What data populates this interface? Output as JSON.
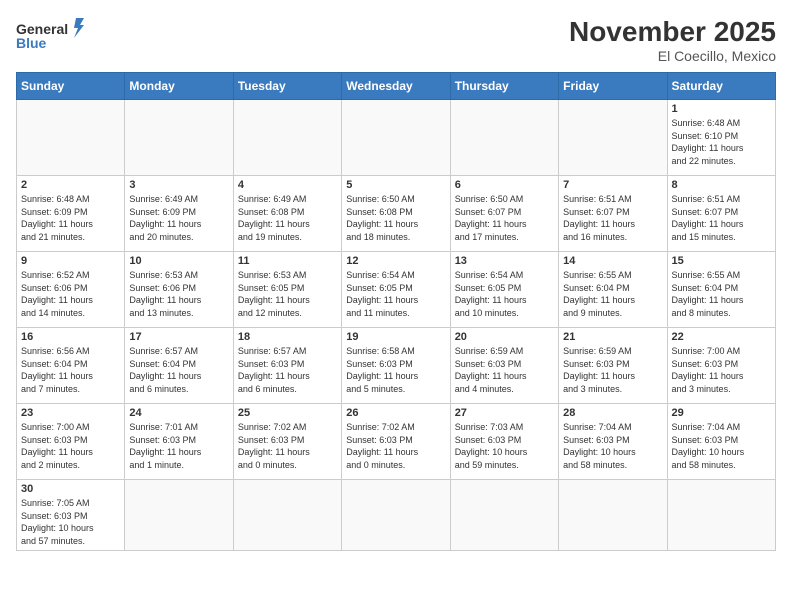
{
  "header": {
    "logo_general": "General",
    "logo_blue": "Blue",
    "title": "November 2025",
    "location": "El Coecillo, Mexico"
  },
  "weekdays": [
    "Sunday",
    "Monday",
    "Tuesday",
    "Wednesday",
    "Thursday",
    "Friday",
    "Saturday"
  ],
  "days": [
    {
      "num": "",
      "info": ""
    },
    {
      "num": "",
      "info": ""
    },
    {
      "num": "",
      "info": ""
    },
    {
      "num": "",
      "info": ""
    },
    {
      "num": "",
      "info": ""
    },
    {
      "num": "",
      "info": ""
    },
    {
      "num": "1",
      "info": "Sunrise: 6:48 AM\nSunset: 6:10 PM\nDaylight: 11 hours\nand 22 minutes."
    },
    {
      "num": "2",
      "info": "Sunrise: 6:48 AM\nSunset: 6:09 PM\nDaylight: 11 hours\nand 21 minutes."
    },
    {
      "num": "3",
      "info": "Sunrise: 6:49 AM\nSunset: 6:09 PM\nDaylight: 11 hours\nand 20 minutes."
    },
    {
      "num": "4",
      "info": "Sunrise: 6:49 AM\nSunset: 6:08 PM\nDaylight: 11 hours\nand 19 minutes."
    },
    {
      "num": "5",
      "info": "Sunrise: 6:50 AM\nSunset: 6:08 PM\nDaylight: 11 hours\nand 18 minutes."
    },
    {
      "num": "6",
      "info": "Sunrise: 6:50 AM\nSunset: 6:07 PM\nDaylight: 11 hours\nand 17 minutes."
    },
    {
      "num": "7",
      "info": "Sunrise: 6:51 AM\nSunset: 6:07 PM\nDaylight: 11 hours\nand 16 minutes."
    },
    {
      "num": "8",
      "info": "Sunrise: 6:51 AM\nSunset: 6:07 PM\nDaylight: 11 hours\nand 15 minutes."
    },
    {
      "num": "9",
      "info": "Sunrise: 6:52 AM\nSunset: 6:06 PM\nDaylight: 11 hours\nand 14 minutes."
    },
    {
      "num": "10",
      "info": "Sunrise: 6:53 AM\nSunset: 6:06 PM\nDaylight: 11 hours\nand 13 minutes."
    },
    {
      "num": "11",
      "info": "Sunrise: 6:53 AM\nSunset: 6:05 PM\nDaylight: 11 hours\nand 12 minutes."
    },
    {
      "num": "12",
      "info": "Sunrise: 6:54 AM\nSunset: 6:05 PM\nDaylight: 11 hours\nand 11 minutes."
    },
    {
      "num": "13",
      "info": "Sunrise: 6:54 AM\nSunset: 6:05 PM\nDaylight: 11 hours\nand 10 minutes."
    },
    {
      "num": "14",
      "info": "Sunrise: 6:55 AM\nSunset: 6:04 PM\nDaylight: 11 hours\nand 9 minutes."
    },
    {
      "num": "15",
      "info": "Sunrise: 6:55 AM\nSunset: 6:04 PM\nDaylight: 11 hours\nand 8 minutes."
    },
    {
      "num": "16",
      "info": "Sunrise: 6:56 AM\nSunset: 6:04 PM\nDaylight: 11 hours\nand 7 minutes."
    },
    {
      "num": "17",
      "info": "Sunrise: 6:57 AM\nSunset: 6:04 PM\nDaylight: 11 hours\nand 6 minutes."
    },
    {
      "num": "18",
      "info": "Sunrise: 6:57 AM\nSunset: 6:03 PM\nDaylight: 11 hours\nand 6 minutes."
    },
    {
      "num": "19",
      "info": "Sunrise: 6:58 AM\nSunset: 6:03 PM\nDaylight: 11 hours\nand 5 minutes."
    },
    {
      "num": "20",
      "info": "Sunrise: 6:59 AM\nSunset: 6:03 PM\nDaylight: 11 hours\nand 4 minutes."
    },
    {
      "num": "21",
      "info": "Sunrise: 6:59 AM\nSunset: 6:03 PM\nDaylight: 11 hours\nand 3 minutes."
    },
    {
      "num": "22",
      "info": "Sunrise: 7:00 AM\nSunset: 6:03 PM\nDaylight: 11 hours\nand 3 minutes."
    },
    {
      "num": "23",
      "info": "Sunrise: 7:00 AM\nSunset: 6:03 PM\nDaylight: 11 hours\nand 2 minutes."
    },
    {
      "num": "24",
      "info": "Sunrise: 7:01 AM\nSunset: 6:03 PM\nDaylight: 11 hours\nand 1 minute."
    },
    {
      "num": "25",
      "info": "Sunrise: 7:02 AM\nSunset: 6:03 PM\nDaylight: 11 hours\nand 0 minutes."
    },
    {
      "num": "26",
      "info": "Sunrise: 7:02 AM\nSunset: 6:03 PM\nDaylight: 11 hours\nand 0 minutes."
    },
    {
      "num": "27",
      "info": "Sunrise: 7:03 AM\nSunset: 6:03 PM\nDaylight: 10 hours\nand 59 minutes."
    },
    {
      "num": "28",
      "info": "Sunrise: 7:04 AM\nSunset: 6:03 PM\nDaylight: 10 hours\nand 58 minutes."
    },
    {
      "num": "29",
      "info": "Sunrise: 7:04 AM\nSunset: 6:03 PM\nDaylight: 10 hours\nand 58 minutes."
    },
    {
      "num": "30",
      "info": "Sunrise: 7:05 AM\nSunset: 6:03 PM\nDaylight: 10 hours\nand 57 minutes."
    },
    {
      "num": "",
      "info": ""
    },
    {
      "num": "",
      "info": ""
    },
    {
      "num": "",
      "info": ""
    },
    {
      "num": "",
      "info": ""
    },
    {
      "num": "",
      "info": ""
    },
    {
      "num": "",
      "info": ""
    }
  ]
}
